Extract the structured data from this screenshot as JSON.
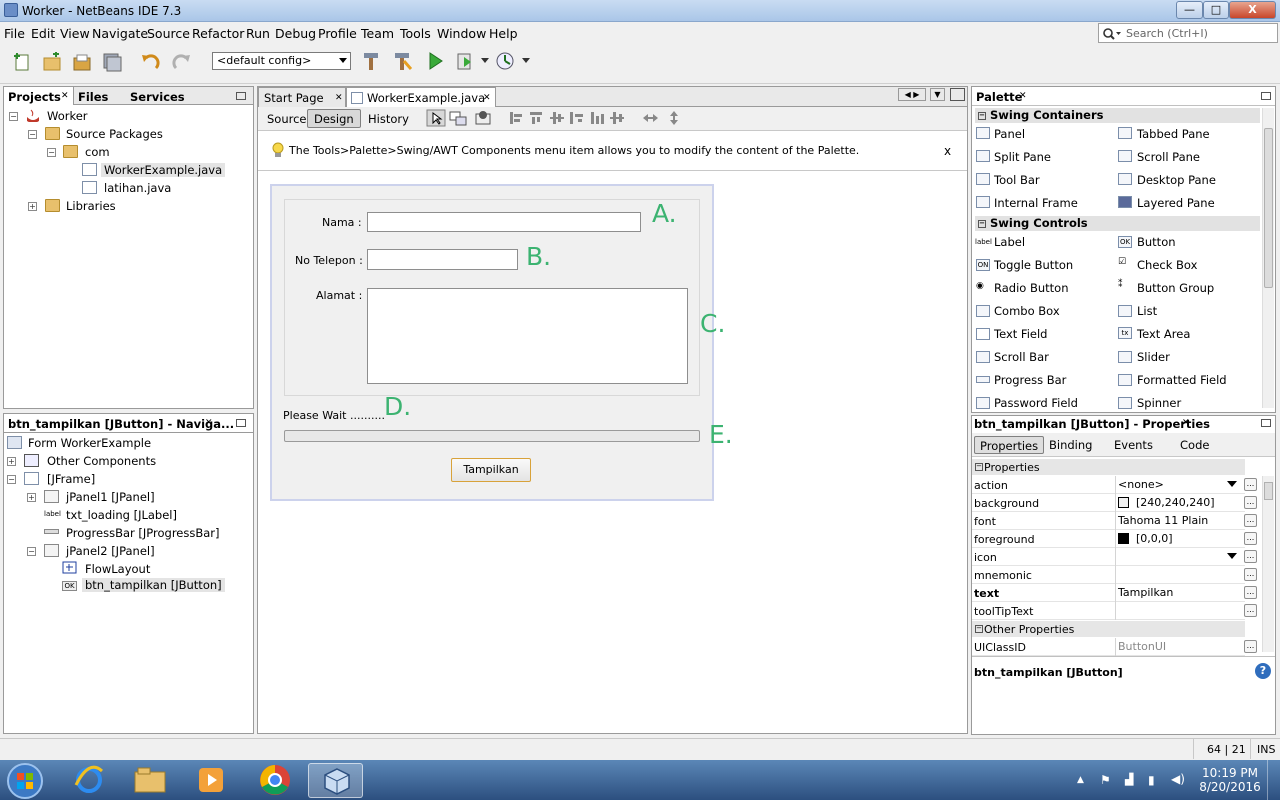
{
  "window": {
    "title": "Worker - NetBeans IDE 7.3",
    "min": "—",
    "max": "□",
    "close": "X"
  },
  "menu": [
    "File",
    "Edit",
    "View",
    "Navigate",
    "Source",
    "Refactor",
    "Run",
    "Debug",
    "Profile",
    "Team",
    "Tools",
    "Window",
    "Help"
  ],
  "search": {
    "placeholder": "Search (Ctrl+I)"
  },
  "toolbar": {
    "config": "<default config>"
  },
  "projects_panel": {
    "tabs": [
      "Projects",
      "Files",
      "Services"
    ],
    "tree": [
      "Worker",
      "Source Packages",
      "com",
      "WorkerExample.java",
      "latihan.java",
      "Libraries"
    ]
  },
  "navigator": {
    "title": "btn_tampilkan [JButton] - Naviga...",
    "tree": [
      "Form WorkerExample",
      "Other Components",
      "[JFrame]",
      "jPanel1 [JPanel]",
      "txt_loading [JLabel]",
      "ProgressBar [JProgressBar]",
      "jPanel2 [JPanel]",
      "FlowLayout",
      "btn_tampilkan [JButton]"
    ],
    "label_icon": "label",
    "ok_icon": "OK"
  },
  "editor": {
    "tabs": [
      "Start Page",
      "WorkerExample.java"
    ],
    "modes": [
      "Source",
      "Design",
      "History"
    ],
    "info": "The Tools>Palette>Swing/AWT Components menu item allows you to modify the content of the Palette.",
    "info_close": "x"
  },
  "form": {
    "nama_label": "Nama :",
    "telepon_label": "No Telepon :",
    "alamat_label": "Alamat :",
    "wait_label": "Please Wait ..........",
    "button": "Tampilkan",
    "letters": [
      "A.",
      "B.",
      "C.",
      "D.",
      "E."
    ]
  },
  "palette": {
    "title": "Palette",
    "containers_title": "Swing Containers",
    "containers": [
      "Panel",
      "Tabbed Pane",
      "Split Pane",
      "Scroll Pane",
      "Tool Bar",
      "Desktop Pane",
      "Internal Frame",
      "Layered Pane"
    ],
    "controls_title": "Swing Controls",
    "controls": [
      "Label",
      "Button",
      "Toggle Button",
      "Check Box",
      "Radio Button",
      "Button Group",
      "Combo Box",
      "List",
      "Text Field",
      "Text Area",
      "Scroll Bar",
      "Slider",
      "Progress Bar",
      "Formatted Field",
      "Password Field",
      "Spinner"
    ],
    "icon_texts": {
      "label": "label",
      "ok": "OK",
      "on": "ON",
      "tx": "tx"
    }
  },
  "properties": {
    "title": "btn_tampilkan [JButton] - Properties",
    "tabs": [
      "Properties",
      "Binding",
      "Events",
      "Code"
    ],
    "section1": "Properties",
    "rows": [
      {
        "k": "action",
        "v": "<none>"
      },
      {
        "k": "background",
        "v": "[240,240,240]"
      },
      {
        "k": "font",
        "v": "Tahoma 11 Plain"
      },
      {
        "k": "foreground",
        "v": "[0,0,0]"
      },
      {
        "k": "icon",
        "v": ""
      },
      {
        "k": "mnemonic",
        "v": ""
      },
      {
        "k": "text",
        "v": "Tampilkan"
      },
      {
        "k": "toolTipText",
        "v": ""
      }
    ],
    "section2": "Other Properties",
    "row_ui": {
      "k": "UIClassID",
      "v": "ButtonUI"
    },
    "footer": "btn_tampilkan [JButton]",
    "help": "?",
    "dots": "...",
    "colors": {
      "background": "#f0f0f0",
      "foreground": "#000000"
    }
  },
  "status": {
    "position": "64 | 21",
    "mode": "INS"
  },
  "taskbar": {
    "time": "10:19 PM",
    "date": "8/20/2016"
  }
}
